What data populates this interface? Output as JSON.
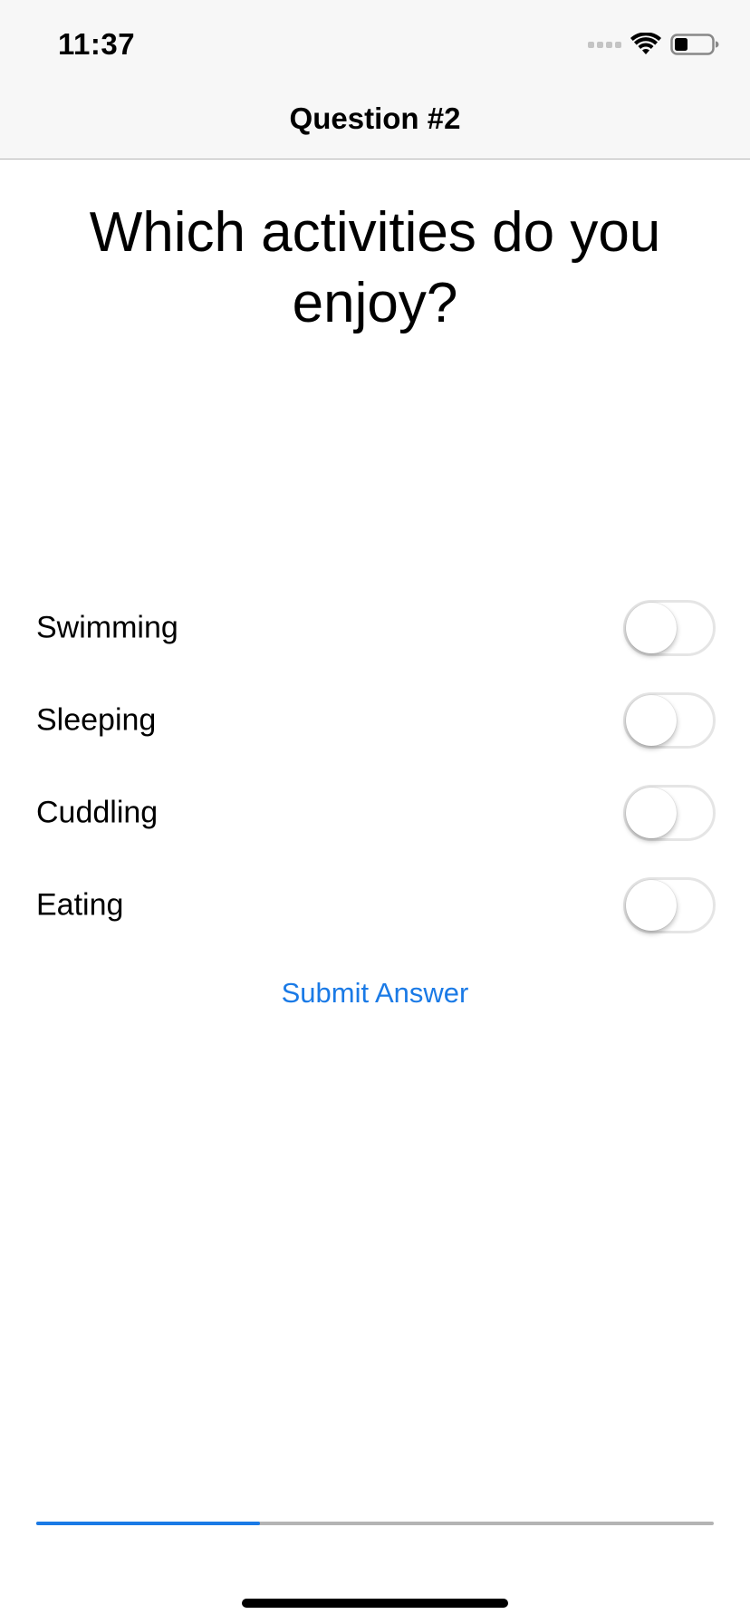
{
  "status_bar": {
    "time": "11:37",
    "icons": [
      "signal-icon",
      "wifi-icon",
      "battery-icon"
    ]
  },
  "nav": {
    "title": "Question #2"
  },
  "question": {
    "text": "Which activities do you enjoy?"
  },
  "options": [
    {
      "label": "Swimming",
      "on": false
    },
    {
      "label": "Sleeping",
      "on": false
    },
    {
      "label": "Cuddling",
      "on": false
    },
    {
      "label": "Eating",
      "on": false
    }
  ],
  "submit": {
    "label": "Submit Answer"
  },
  "progress": {
    "fraction": 0.33
  },
  "colors": {
    "accent": "#1a7ae6",
    "progress_track": "#b4b4b4",
    "nav_background": "#f7f7f7"
  }
}
